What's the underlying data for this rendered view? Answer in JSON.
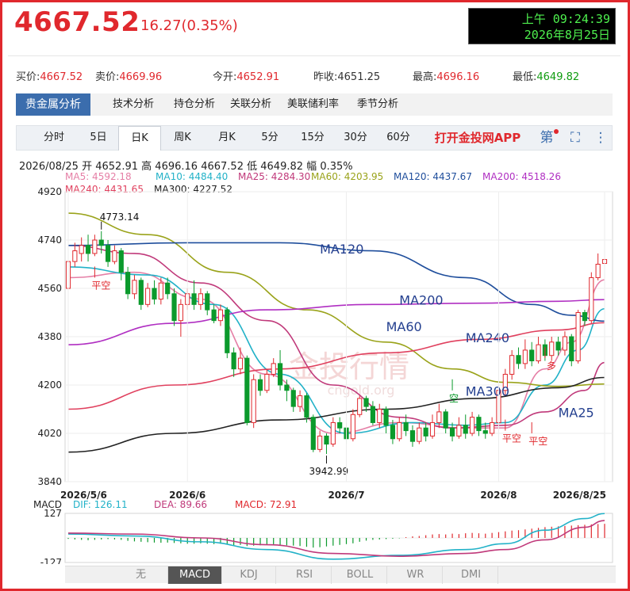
{
  "header": {
    "price": "4667.52",
    "change": "16.27(0.35%)",
    "clock_time": "上午 09:24:39",
    "clock_date": "2026年8月25日"
  },
  "quote": [
    {
      "label": "买价:",
      "value": "4667.52",
      "tone": "red"
    },
    {
      "label": "卖价:",
      "value": "4669.96",
      "tone": "red"
    },
    {
      "label": "今开:",
      "value": "4652.91",
      "tone": "red"
    },
    {
      "label": "昨收:",
      "value": "4651.25",
      "tone": "dark"
    },
    {
      "label": "最高:",
      "value": "4696.16",
      "tone": "red"
    },
    {
      "label": "最低:",
      "value": "4649.82",
      "tone": "green"
    }
  ],
  "nav_tabs": [
    "贵金属分析",
    "技术分析",
    "持仓分析",
    "关联分析",
    "美联储利率",
    "季节分析"
  ],
  "period_tabs": [
    "分时",
    "5日",
    "日K",
    "周K",
    "月K",
    "5分",
    "15分",
    "30分",
    "60分"
  ],
  "active_period": "日K",
  "app_link": "打开金投网APP",
  "ohlc": {
    "date": "2026/08/25",
    "open_label": "开",
    "open": "4652.91",
    "high_label": "高",
    "high": "4696.16",
    "low_label": "低",
    "low": "4649.82",
    "close": "4667.52",
    "amp_label": "幅",
    "amp": "0.35%"
  },
  "ma_legend": [
    {
      "text": "MA5: 4592.18",
      "color": "#e57fa6"
    },
    {
      "text": "MA10: 4484.40",
      "color": "#22b2c8"
    },
    {
      "text": "MA25: 4284.30",
      "color": "#c0397a"
    },
    {
      "text": "MA60: 4203.95",
      "color": "#9aa31a"
    },
    {
      "text": "MA120: 4437.67",
      "color": "#1f4e9c"
    },
    {
      "text": "MA200: 4518.26",
      "color": "#b02fc2"
    },
    {
      "text": "MA240: 4431.65",
      "color": "#e0405e"
    },
    {
      "text": "MA300: 4227.52",
      "color": "#222222"
    }
  ],
  "macd_legend": {
    "label": "MACD",
    "dif": "DIF: 126.11",
    "dea": "DEA: 89.66",
    "macd": "MACD: 72.91"
  },
  "bottom_tabs": [
    "无",
    "MACD",
    "KDJ",
    "RSI",
    "BOLL",
    "WR",
    "DMI"
  ],
  "active_bottom": "MACD",
  "colors": {
    "up": "#e0282d",
    "down": "#0b9a2c",
    "accent": "#3b6dad"
  },
  "chart_data": {
    "type": "candlestick",
    "ylim": [
      3840,
      4920
    ],
    "yticks": [
      "4920",
      "4740",
      "4560",
      "4380",
      "4200",
      "4020",
      "3840"
    ],
    "xticks": [
      {
        "label": "2026/5/6",
        "index": 0
      },
      {
        "label": "2026/6",
        "index": 18
      },
      {
        "label": "2026/7",
        "index": 42
      },
      {
        "label": "2026/8",
        "index": 65
      },
      {
        "label": "2026/8/25",
        "index": 81
      }
    ],
    "annotations": {
      "high": {
        "text": "4773.14",
        "index": 5,
        "value": 4773.14
      },
      "low": {
        "text": "3942.99",
        "index": 39,
        "value": 3942.99
      },
      "watermark": "金投行情",
      "watermark_url": "cngold.org",
      "signals": [
        {
          "text": "平空",
          "index": 4,
          "value": 4600
        },
        {
          "text": "空",
          "index": 58,
          "value": 4180
        },
        {
          "text": "平空",
          "index": 66,
          "value": 4030
        },
        {
          "text": "平空",
          "index": 70,
          "value": 4020
        },
        {
          "text": "多",
          "index": 72,
          "value": 4300
        }
      ]
    },
    "ma_line_labels": [
      {
        "text": "MA120",
        "index": 38,
        "value": 4690
      },
      {
        "text": "MA200",
        "index": 50,
        "value": 4500
      },
      {
        "text": "MA60",
        "index": 48,
        "value": 4400
      },
      {
        "text": "MA240",
        "index": 60,
        "value": 4360
      },
      {
        "text": "MA300",
        "index": 60,
        "value": 4160
      },
      {
        "text": "MA25",
        "index": 74,
        "value": 4080
      }
    ],
    "candles": [
      [
        4560,
        4660,
        4690,
        4550
      ],
      [
        4660,
        4700,
        4730,
        4640
      ],
      [
        4690,
        4720,
        4750,
        4660
      ],
      [
        4720,
        4690,
        4760,
        4660
      ],
      [
        4690,
        4740,
        4760,
        4680
      ],
      [
        4740,
        4720,
        4773.14,
        4690
      ],
      [
        4720,
        4660,
        4740,
        4640
      ],
      [
        4660,
        4700,
        4720,
        4650
      ],
      [
        4700,
        4620,
        4710,
        4590
      ],
      [
        4620,
        4540,
        4640,
        4520
      ],
      [
        4540,
        4590,
        4610,
        4520
      ],
      [
        4590,
        4500,
        4600,
        4480
      ],
      [
        4500,
        4560,
        4580,
        4490
      ],
      [
        4560,
        4520,
        4590,
        4500
      ],
      [
        4520,
        4580,
        4600,
        4500
      ],
      [
        4580,
        4540,
        4600,
        4520
      ],
      [
        4540,
        4440,
        4560,
        4420
      ],
      [
        4440,
        4500,
        4520,
        4380
      ],
      [
        4500,
        4540,
        4560,
        4480
      ],
      [
        4540,
        4500,
        4590,
        4480
      ],
      [
        4500,
        4540,
        4560,
        4480
      ],
      [
        4540,
        4480,
        4550,
        4460
      ],
      [
        4480,
        4440,
        4500,
        4430
      ],
      [
        4440,
        4480,
        4500,
        4420
      ],
      [
        4480,
        4320,
        4490,
        4300
      ],
      [
        4320,
        4260,
        4340,
        4230
      ],
      [
        4260,
        4300,
        4340,
        4240
      ],
      [
        4300,
        4060,
        4310,
        4050
      ],
      [
        4060,
        4220,
        4240,
        4040
      ],
      [
        4220,
        4180,
        4240,
        4160
      ],
      [
        4180,
        4240,
        4260,
        4170
      ],
      [
        4240,
        4280,
        4300,
        4230
      ],
      [
        4280,
        4200,
        4330,
        4180
      ],
      [
        4200,
        4180,
        4220,
        4140
      ],
      [
        4180,
        4120,
        4190,
        4100
      ],
      [
        4120,
        4160,
        4180,
        4100
      ],
      [
        4160,
        4080,
        4170,
        4060
      ],
      [
        4080,
        3960,
        4090,
        3950
      ],
      [
        3960,
        4010,
        4030,
        3950
      ],
      [
        4010,
        3980,
        4020,
        3942.99
      ],
      [
        3980,
        4060,
        4080,
        3970
      ],
      [
        4060,
        4040,
        4080,
        4020
      ],
      [
        4040,
        4000,
        4060,
        3980
      ],
      [
        4000,
        4090,
        4110,
        3990
      ],
      [
        4090,
        4150,
        4160,
        4080
      ],
      [
        4150,
        4120,
        4160,
        4100
      ],
      [
        4120,
        4060,
        4140,
        4050
      ],
      [
        4060,
        4110,
        4130,
        4040
      ],
      [
        4110,
        4050,
        4120,
        4020
      ],
      [
        4050,
        4000,
        4070,
        3980
      ],
      [
        4000,
        4060,
        4080,
        3990
      ],
      [
        4060,
        4030,
        4090,
        4010
      ],
      [
        4030,
        3990,
        4050,
        3970
      ],
      [
        3990,
        4040,
        4060,
        3980
      ],
      [
        4040,
        4010,
        4060,
        3990
      ],
      [
        4010,
        4060,
        4090,
        4000
      ],
      [
        4060,
        4100,
        4130,
        4040
      ],
      [
        4100,
        4040,
        4110,
        4020
      ],
      [
        4040,
        4010,
        4060,
        3990
      ],
      [
        4010,
        4050,
        4080,
        4000
      ],
      [
        4050,
        4020,
        4090,
        4000
      ],
      [
        4020,
        4080,
        4100,
        4010
      ],
      [
        4080,
        4030,
        4090,
        4010
      ],
      [
        4030,
        4020,
        4060,
        4000
      ],
      [
        4020,
        4060,
        4080,
        4010
      ],
      [
        4060,
        4180,
        4200,
        4050
      ],
      [
        4180,
        4240,
        4260,
        4160
      ],
      [
        4240,
        4310,
        4330,
        4220
      ],
      [
        4310,
        4280,
        4340,
        4260
      ],
      [
        4280,
        4330,
        4370,
        4260
      ],
      [
        4330,
        4290,
        4360,
        4270
      ],
      [
        4290,
        4350,
        4380,
        4280
      ],
      [
        4350,
        4310,
        4370,
        4290
      ],
      [
        4310,
        4360,
        4380,
        4290
      ],
      [
        4360,
        4330,
        4380,
        4310
      ],
      [
        4330,
        4380,
        4400,
        4310
      ],
      [
        4380,
        4290,
        4390,
        4270
      ],
      [
        4290,
        4470,
        4480,
        4280
      ],
      [
        4470,
        4440,
        4480,
        4420
      ],
      [
        4440,
        4600,
        4620,
        4430
      ],
      [
        4600,
        4650,
        4690,
        4590
      ],
      [
        4652.91,
        4667.52,
        4696.16,
        4649.82
      ]
    ],
    "ma_series": [
      {
        "name": "MA5",
        "color": "#e57fa6",
        "points": [
          [
            0,
            4600
          ],
          [
            10,
            4620
          ],
          [
            20,
            4520
          ],
          [
            30,
            4240
          ],
          [
            40,
            4020
          ],
          [
            50,
            4060
          ],
          [
            60,
            4040
          ],
          [
            66,
            4040
          ],
          [
            72,
            4260
          ],
          [
            76,
            4360
          ],
          [
            81,
            4592
          ]
        ]
      },
      {
        "name": "MA10",
        "color": "#22b2c8",
        "points": [
          [
            0,
            4640
          ],
          [
            12,
            4610
          ],
          [
            22,
            4500
          ],
          [
            32,
            4240
          ],
          [
            42,
            4020
          ],
          [
            52,
            4060
          ],
          [
            60,
            4050
          ],
          [
            66,
            4060
          ],
          [
            72,
            4200
          ],
          [
            77,
            4330
          ],
          [
            81,
            4484
          ]
        ]
      },
      {
        "name": "MA25",
        "color": "#c0397a",
        "points": [
          [
            0,
            4720
          ],
          [
            10,
            4690
          ],
          [
            20,
            4580
          ],
          [
            30,
            4440
          ],
          [
            40,
            4200
          ],
          [
            50,
            4080
          ],
          [
            58,
            4040
          ],
          [
            66,
            4050
          ],
          [
            72,
            4100
          ],
          [
            78,
            4180
          ],
          [
            81,
            4284
          ]
        ]
      },
      {
        "name": "MA60",
        "color": "#9aa31a",
        "points": [
          [
            0,
            4840
          ],
          [
            12,
            4760
          ],
          [
            24,
            4620
          ],
          [
            36,
            4480
          ],
          [
            48,
            4360
          ],
          [
            58,
            4260
          ],
          [
            66,
            4210
          ],
          [
            74,
            4195
          ],
          [
            81,
            4204
          ]
        ]
      },
      {
        "name": "MA120",
        "color": "#1f4e9c",
        "points": [
          [
            0,
            4720
          ],
          [
            18,
            4730
          ],
          [
            32,
            4730
          ],
          [
            46,
            4700
          ],
          [
            60,
            4600
          ],
          [
            70,
            4500
          ],
          [
            76,
            4460
          ],
          [
            81,
            4438
          ]
        ]
      },
      {
        "name": "MA200",
        "color": "#b02fc2",
        "points": [
          [
            0,
            4350
          ],
          [
            16,
            4430
          ],
          [
            30,
            4480
          ],
          [
            46,
            4500
          ],
          [
            62,
            4505
          ],
          [
            74,
            4512
          ],
          [
            81,
            4518
          ]
        ]
      },
      {
        "name": "MA240",
        "color": "#e0405e",
        "points": [
          [
            0,
            4110
          ],
          [
            16,
            4200
          ],
          [
            32,
            4260
          ],
          [
            48,
            4320
          ],
          [
            62,
            4370
          ],
          [
            74,
            4405
          ],
          [
            81,
            4432
          ]
        ]
      },
      {
        "name": "MA300",
        "color": "#222222",
        "points": [
          [
            0,
            3950
          ],
          [
            16,
            4020
          ],
          [
            32,
            4070
          ],
          [
            48,
            4110
          ],
          [
            62,
            4150
          ],
          [
            74,
            4190
          ],
          [
            81,
            4228
          ]
        ]
      }
    ],
    "macd": {
      "ylim": [
        -127,
        127
      ],
      "yticks": [
        "127",
        "-127"
      ],
      "dif": [
        [
          0,
          20
        ],
        [
          10,
          10
        ],
        [
          20,
          -20
        ],
        [
          30,
          -60
        ],
        [
          40,
          -110
        ],
        [
          50,
          -90
        ],
        [
          60,
          -60
        ],
        [
          66,
          -30
        ],
        [
          72,
          40
        ],
        [
          78,
          100
        ],
        [
          81,
          126
        ]
      ],
      "dea": [
        [
          0,
          25
        ],
        [
          10,
          20
        ],
        [
          20,
          0
        ],
        [
          30,
          -35
        ],
        [
          40,
          -80
        ],
        [
          50,
          -95
        ],
        [
          60,
          -80
        ],
        [
          66,
          -60
        ],
        [
          72,
          -10
        ],
        [
          78,
          55
        ],
        [
          81,
          90
        ]
      ],
      "hist": [
        -5,
        -8,
        -10,
        -12,
        -10,
        -8,
        -6,
        -8,
        -10,
        -15,
        -18,
        -20,
        -22,
        -24,
        -25,
        -24,
        -26,
        -28,
        -30,
        -30,
        -28,
        -30,
        -32,
        -30,
        -34,
        -38,
        -36,
        -42,
        -40,
        -38,
        -36,
        -34,
        -36,
        -38,
        -40,
        -42,
        -46,
        -50,
        -48,
        -44,
        -40,
        -36,
        -32,
        -28,
        -20,
        -14,
        -10,
        -8,
        -6,
        -4,
        -2,
        4,
        8,
        10,
        14,
        18,
        20,
        18,
        22,
        20,
        24,
        26,
        24,
        22,
        26,
        30,
        34,
        38,
        40,
        44,
        48,
        52,
        56,
        58,
        60,
        62,
        64,
        66,
        68,
        70,
        72,
        73
      ]
    }
  }
}
